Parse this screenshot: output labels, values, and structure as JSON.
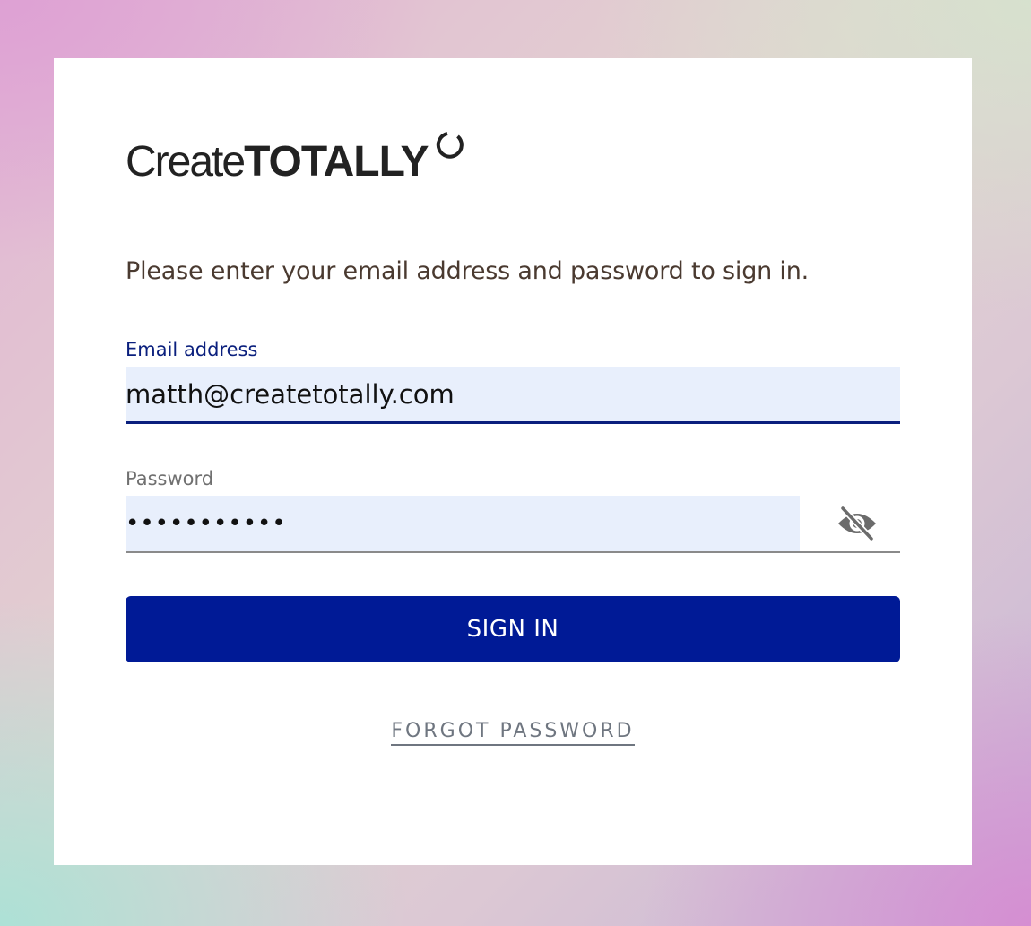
{
  "brand": {
    "name_part1": "Create",
    "name_part2": "TOTALLY",
    "logo_icon": "ring-icon"
  },
  "intro_text": "Please enter your email address and password to sign in.",
  "email": {
    "label": "Email address",
    "value": "matth@createtotally.com"
  },
  "password": {
    "label": "Password",
    "value": "•••••••••••",
    "toggle_icon": "eye-off-icon"
  },
  "sign_in_label": "SIGN IN",
  "forgot_label": "FORGOT PASSWORD",
  "colors": {
    "primary": "#001a96",
    "focus_label": "#0a1f7d",
    "input_fill": "#e8effc",
    "link": "#6f7680"
  }
}
